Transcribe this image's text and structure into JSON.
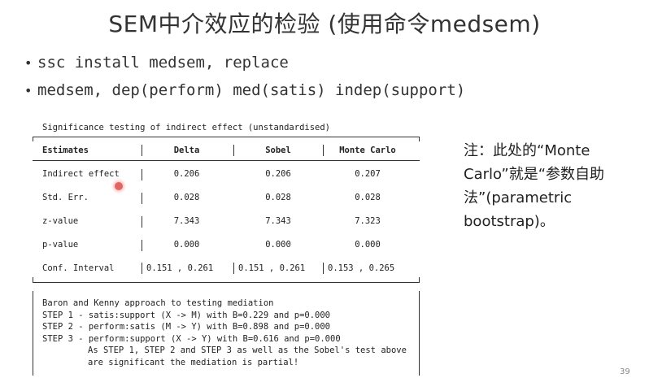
{
  "slide": {
    "title": "SEM中介效应的检验 (使用命令medsem)",
    "bullets": [
      "ssc install medsem, replace",
      "medsem, dep(perform) med(satis) indep(support)"
    ],
    "page_number": "39"
  },
  "output": {
    "caption": "Significance testing of indirect effect (unstandardised)",
    "headers": [
      "Estimates",
      "Delta",
      "Sobel",
      "Monte Carlo"
    ],
    "rows": [
      {
        "label": "Indirect effect",
        "delta": "0.206",
        "sobel": "0.206",
        "mc": "0.207"
      },
      {
        "label": "Std. Err.",
        "delta": "0.028",
        "sobel": "0.028",
        "mc": "0.028"
      },
      {
        "label": "z-value",
        "delta": "7.343",
        "sobel": "7.343",
        "mc": "7.323"
      },
      {
        "label": "p-value",
        "delta": "0.000",
        "sobel": "0.000",
        "mc": "0.000"
      },
      {
        "label": "Conf. Interval",
        "delta": "0.151 , 0.261",
        "sobel": "0.151 , 0.261",
        "mc": "0.153 , 0.265"
      }
    ],
    "baron_kenny": [
      "Baron and Kenny approach to testing mediation",
      "STEP 1 - satis:support (X -> M) with B=0.229 and p=0.000",
      "STEP 2 - perform:satis (M -> Y) with B=0.898 and p=0.000",
      "STEP 3 - perform:support (X -> Y) with B=0.616 and p=0.000",
      "As STEP 1, STEP 2 and STEP 3 as well as the Sobel's test above",
      "are significant the mediation is partial!"
    ]
  },
  "note": {
    "text": "注：此处的“Monte Carlo”就是“参数自助法”(parametric bootstrap)。"
  }
}
